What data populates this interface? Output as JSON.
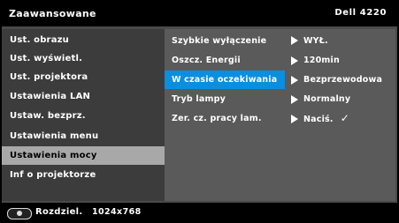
{
  "header": {
    "title": "Zaawansowane",
    "model": "Dell 4220"
  },
  "left_menu": [
    {
      "label": "Ust. obrazu"
    },
    {
      "label": "Ust. wyświetl."
    },
    {
      "label": "Ust. projektora"
    },
    {
      "label": "Ustawienia LAN"
    },
    {
      "label": "Ustaw. bezprz."
    },
    {
      "label": "Ustawienia menu"
    },
    {
      "label": "Ustawienia mocy",
      "selected": true
    },
    {
      "label": "Inf o projektorze"
    }
  ],
  "settings": [
    {
      "label": "Szybkie wyłączenie",
      "value": "WYŁ."
    },
    {
      "label": "Oszcz. Energii",
      "value": "120min"
    },
    {
      "label": "W czasie oczekiwania",
      "value": "Bezprzewodowa",
      "highlighted": true
    },
    {
      "label": "Tryb lampy",
      "value": "Normalny"
    },
    {
      "label": "Zer. cz. pracy lam.",
      "value": "Naciś.",
      "check": "✓"
    }
  ],
  "footer": {
    "resolution_label": "Rozdziel.",
    "resolution_value": "1024x768",
    "icon": "projector-icon"
  },
  "colors": {
    "highlight": "#0a8ee0",
    "selected": "#a8a8a8",
    "panel": "#5a5a5a",
    "menu": "#3c3c3c"
  }
}
